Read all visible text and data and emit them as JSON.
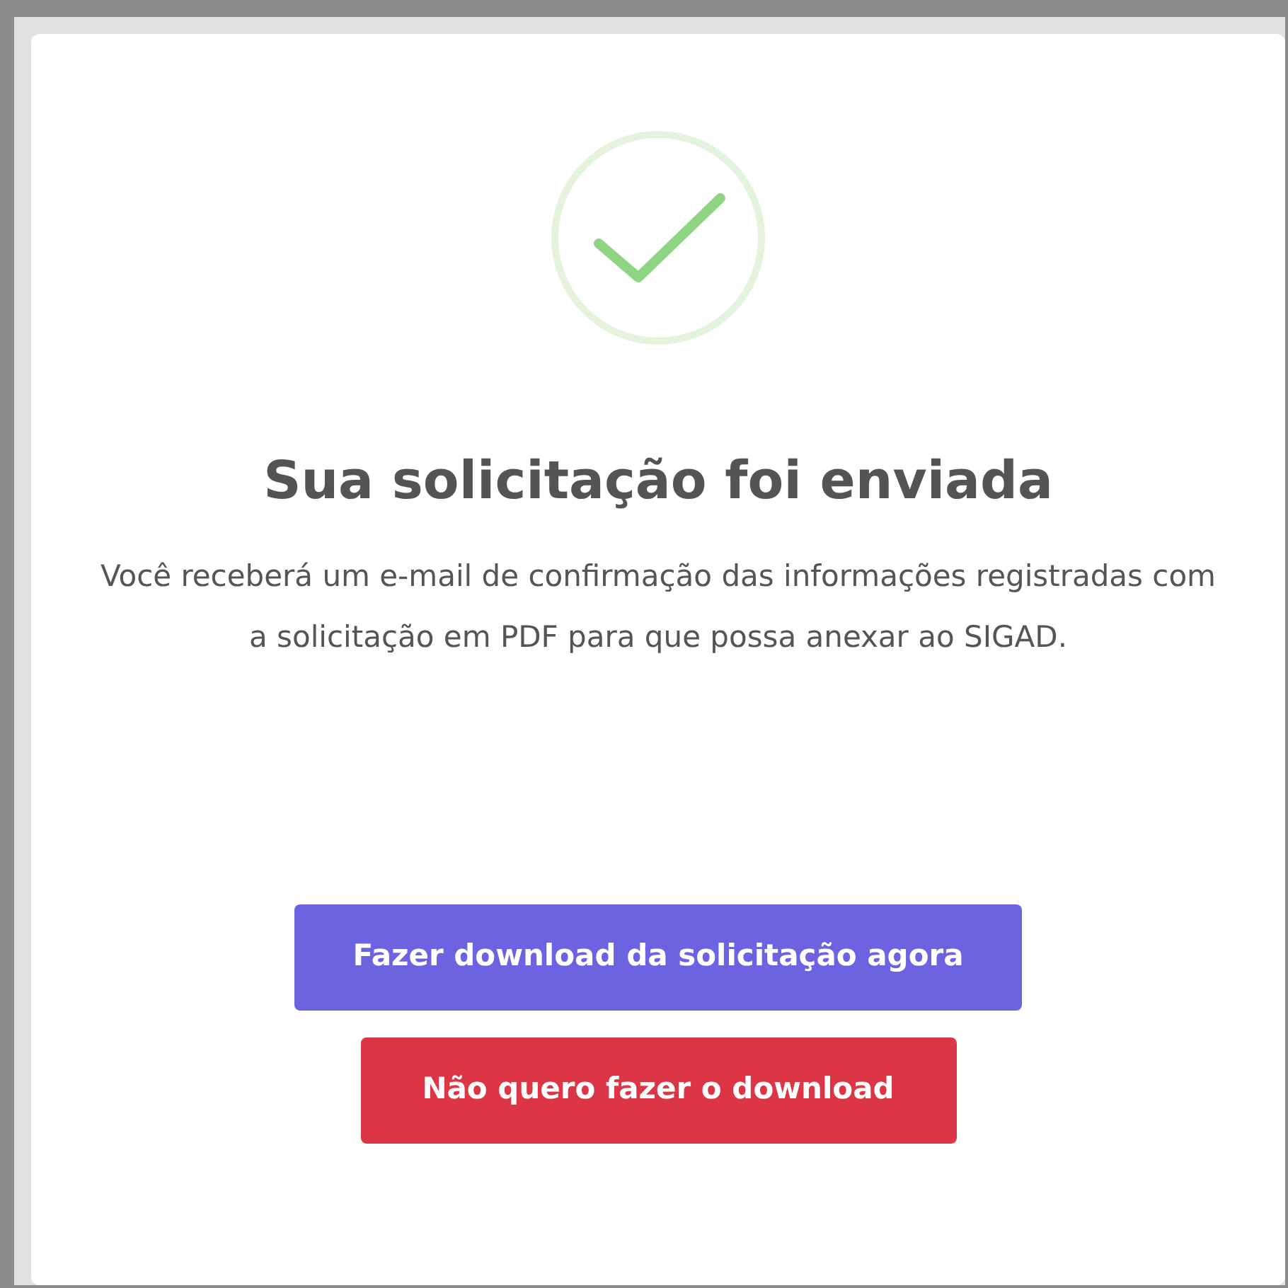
{
  "dialog": {
    "title": "Sua solicitação foi enviada",
    "message": "Você receberá um e-mail de confirmação das informações registradas com a solicitação em PDF para que possa anexar ao SIGAD.",
    "buttons": [
      {
        "label": "Fazer download da solicitação agora",
        "kind": "primary"
      },
      {
        "label": "Não quero fazer o download",
        "kind": "danger"
      }
    ]
  }
}
